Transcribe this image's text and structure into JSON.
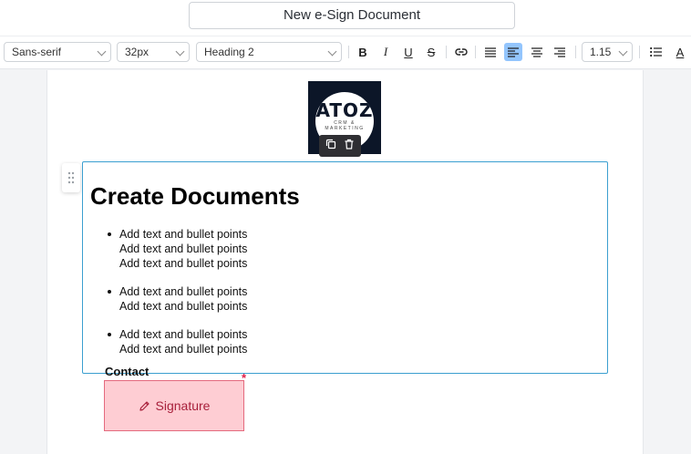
{
  "header": {
    "document_title": "New e-Sign Document"
  },
  "toolbar": {
    "font_family": "Sans-serif",
    "font_size": "32px",
    "block_style": "Heading 2",
    "line_height": "1.15",
    "buttons": [
      "bold-icon",
      "italic-icon",
      "underline-icon",
      "strikethrough-icon",
      "link-icon",
      "justify-icon",
      "align-left-icon",
      "align-center-icon",
      "align-right-icon",
      "bullet-list-icon",
      "text-color-icon"
    ],
    "active_button": "align-left-icon",
    "text_color_indicator": "A"
  },
  "logo": {
    "main": "ATOZ",
    "sub": "CRM & MARKETING"
  },
  "content": {
    "heading": "Create Documents",
    "bullets": [
      [
        "Add text and bullet points",
        "Add text and bullet points",
        "Add text and bullet points"
      ],
      [
        "Add text and bullet points",
        "Add text and bullet points"
      ],
      [
        "Add text and bullet points",
        "Add text and bullet points"
      ]
    ]
  },
  "contact_label": "Contact",
  "signature": {
    "label": "Signature",
    "required_mark": "*"
  },
  "colors": {
    "active": "#93c5fd",
    "block_border": "#3b9fd0",
    "signature_bg": "#fecdd3",
    "signature_text": "#a8203b",
    "required": "#e11d48"
  }
}
